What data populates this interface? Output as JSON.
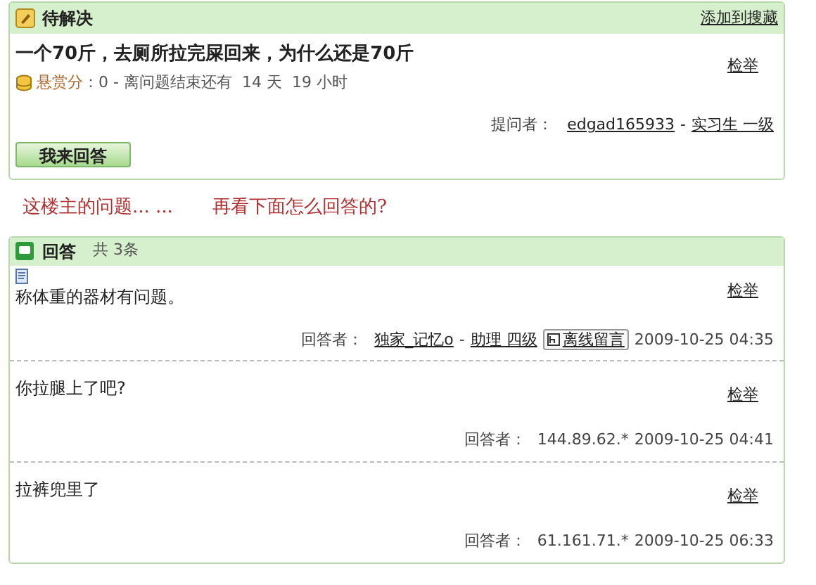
{
  "question_panel": {
    "status": "待解决",
    "header_link": "添加到搜藏",
    "title": "一个70斤，去厕所拉完屎回来，为什么还是70斤",
    "report_link": "检举",
    "reward_label": "悬赏分",
    "reward_rest": "：0 - 离问题结束还有  14 天  19 小时",
    "asker_label": "提问者：",
    "asker_name": "edgad165933",
    "separator": "-",
    "asker_rank": "实习生 一级",
    "answer_button": "我来回答"
  },
  "annotations": [
    "这楼主的问题... ...",
    "再看下面怎么回答的?"
  ],
  "answers_panel": {
    "title": "回答",
    "count": "共 3条",
    "answers": [
      {
        "kind": "user",
        "text": "称体重的器材有问题。",
        "report_link": "检举",
        "answerer_label": "回答者：",
        "answerer": "独家_记忆o",
        "separator": "-",
        "rank": "助理 四级",
        "message_button": "离线留言",
        "time": "2009-10-25 04:35"
      },
      {
        "kind": "ip",
        "text": "你拉腿上了吧?",
        "report_link": "检举",
        "answerer_label": "回答者：",
        "answerer": "144.89.62.*",
        "time": "2009-10-25 04:41"
      },
      {
        "kind": "ip",
        "text": "拉裤兜里了",
        "report_link": "检举",
        "answerer_label": "回答者：",
        "answerer": "61.161.71.*",
        "time": "2009-10-25 06:33"
      }
    ]
  }
}
